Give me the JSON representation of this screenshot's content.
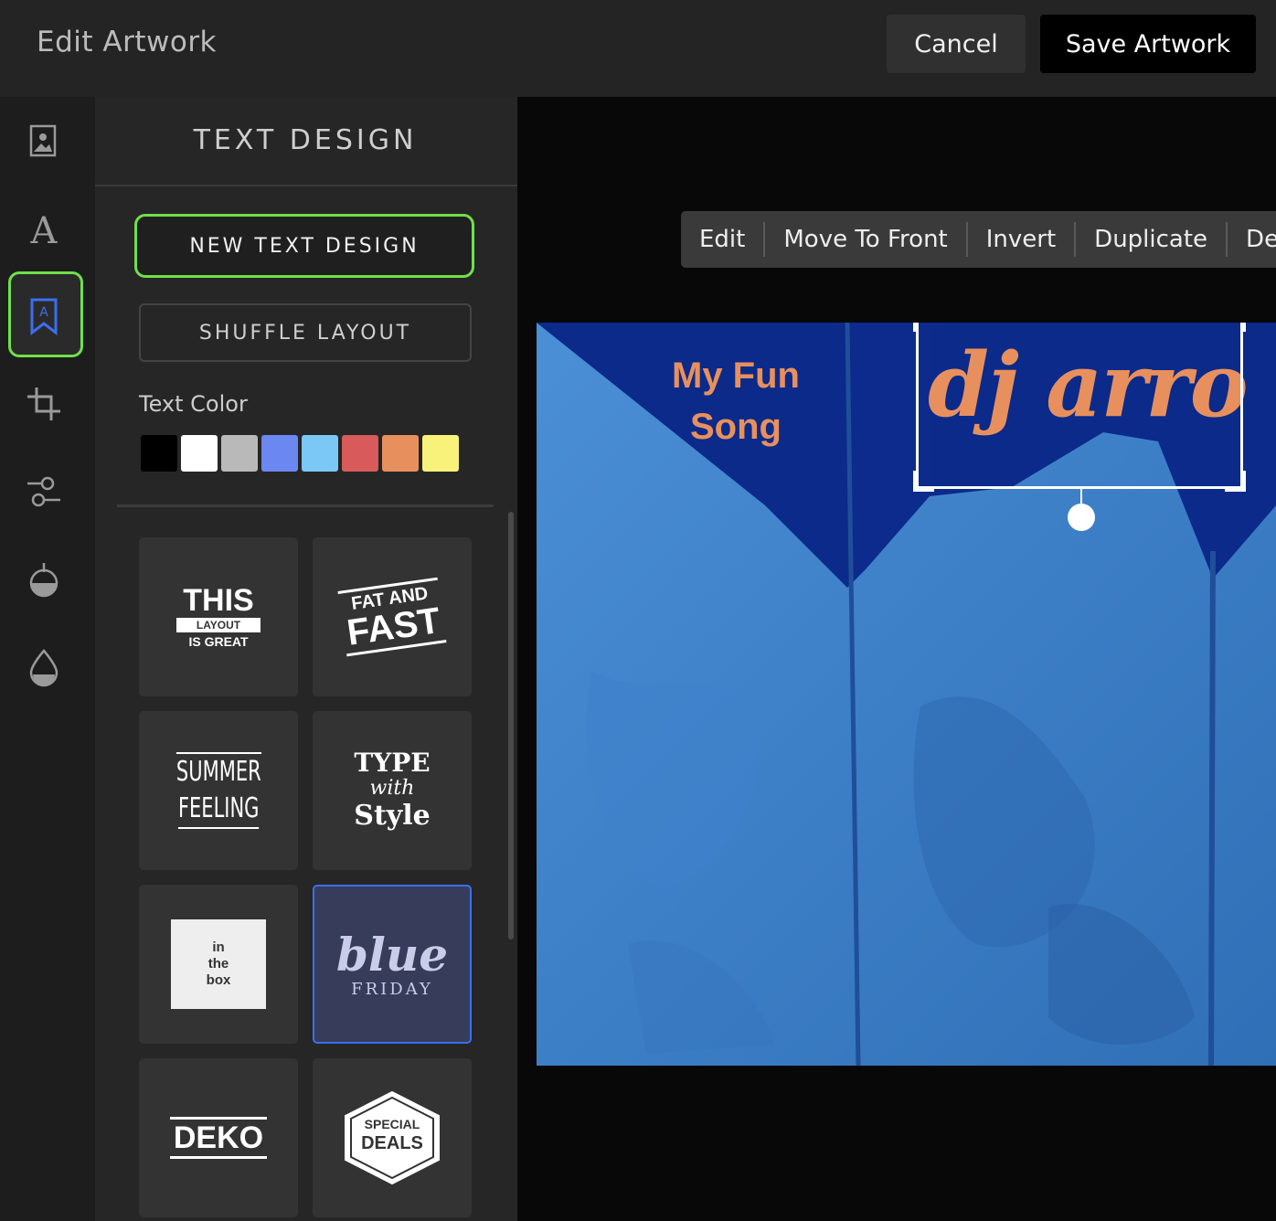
{
  "header": {
    "title": "Edit Artwork",
    "cancel_label": "Cancel",
    "save_label": "Save Artwork"
  },
  "rail": {
    "items": [
      "photo-icon",
      "text-icon",
      "text-design-icon",
      "crop-icon",
      "adjust-icon",
      "filter-icon",
      "color-drop-icon"
    ],
    "active": "text-design-icon"
  },
  "panel": {
    "title": "TEXT DESIGN",
    "new_text_design_label": "NEW TEXT DESIGN",
    "shuffle_layout_label": "SHUFFLE LAYOUT",
    "text_color_label": "Text Color",
    "colors": [
      "#000000",
      "#ffffff",
      "#b9b9b9",
      "#6b87f2",
      "#7bc7f5",
      "#d85a5a",
      "#e8905d",
      "#f8f27a"
    ],
    "tiles": [
      {
        "lines": [
          "THIS",
          "LAYOUT",
          "IS GREAT"
        ]
      },
      {
        "lines": [
          "FAT AND",
          "FAST"
        ]
      },
      {
        "lines": [
          "SUMMER",
          "FEELING"
        ]
      },
      {
        "lines": [
          "TYPE",
          "with",
          "Style"
        ]
      },
      {
        "lines": [
          "in",
          "the",
          "box"
        ]
      },
      {
        "lines": [
          "blue",
          "FRIDAY"
        ],
        "selected": true
      },
      {
        "lines": [
          "DEKO"
        ]
      },
      {
        "lines": [
          "SPECIAL",
          "DEALS"
        ]
      }
    ]
  },
  "context_menu": {
    "items": [
      "Edit",
      "Move To Front",
      "Invert",
      "Duplicate",
      "Dele"
    ]
  },
  "artwork": {
    "song_line1": "My Fun",
    "song_line2": "Song",
    "artist": "dj arro",
    "text_color": "#e8905d"
  }
}
